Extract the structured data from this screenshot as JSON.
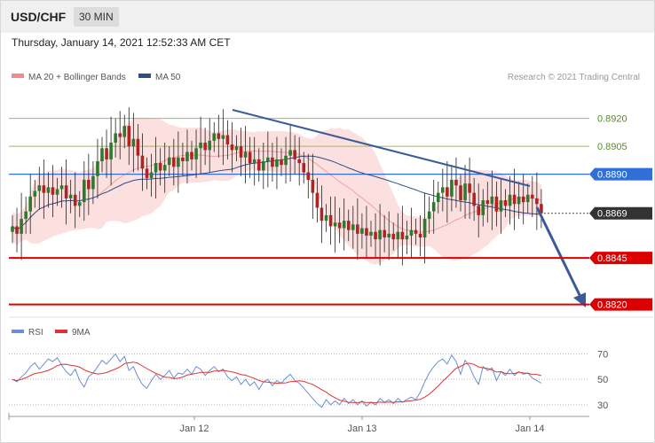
{
  "header": {
    "symbol": "USD/CHF",
    "timeframe": "30 MIN",
    "datetime": "Thursday, January 14, 2021 12:52:33 AM CET"
  },
  "legend": {
    "bb_label": "MA 20 + Bollinger Bands",
    "ma50_label": "MA 50",
    "credit": "Research © 2021 Trading Central",
    "rsi_label": "RSI",
    "ma9_label": "9MA"
  },
  "colors": {
    "up": "#2d7a2d",
    "down": "#b22222",
    "bb": "#f4aaaa",
    "ma50": "#2d4f8a",
    "trend": "#3a5a99",
    "blue_level": "#2f6fd6",
    "red_level": "#dd0000",
    "green_level": "#9bbb59",
    "rsi": "#6b8ed6",
    "rsi_ma": "#dd3333"
  },
  "chart_data": [
    {
      "type": "candlestick",
      "ylim": [
        0.8816,
        0.8937
      ],
      "x_ticks": [
        "Jan 12",
        "Jan 13",
        "Jan 14"
      ],
      "levels": [
        {
          "value": 0.892,
          "label": "0.8920",
          "style": "green"
        },
        {
          "value": 0.8905,
          "label": "0.8905",
          "style": "green"
        },
        {
          "value": 0.889,
          "label": "0.8890",
          "style": "blue"
        },
        {
          "value": 0.8869,
          "label": "0.8869",
          "style": "current"
        },
        {
          "value": 0.8845,
          "label": "0.8845",
          "style": "red"
        },
        {
          "value": 0.882,
          "label": "0.8820",
          "style": "red"
        }
      ],
      "close": [
        0.8862,
        0.8858,
        0.8866,
        0.887,
        0.8878,
        0.8881,
        0.8884,
        0.888,
        0.8883,
        0.8879,
        0.8882,
        0.8884,
        0.8877,
        0.8879,
        0.8873,
        0.8875,
        0.8887,
        0.8882,
        0.8889,
        0.8897,
        0.8904,
        0.8898,
        0.8907,
        0.8912,
        0.891,
        0.8916,
        0.8905,
        0.8909,
        0.89,
        0.8893,
        0.8888,
        0.8891,
        0.8896,
        0.8892,
        0.8895,
        0.8899,
        0.8894,
        0.8899,
        0.8897,
        0.8902,
        0.8898,
        0.8904,
        0.8907,
        0.8903,
        0.8908,
        0.8912,
        0.8909,
        0.8911,
        0.8906,
        0.8903,
        0.8905,
        0.8899,
        0.8902,
        0.8896,
        0.8898,
        0.8892,
        0.8897,
        0.8899,
        0.8894,
        0.8898,
        0.8895,
        0.89,
        0.8903,
        0.8898,
        0.8896,
        0.8891,
        0.8887,
        0.888,
        0.8872,
        0.8865,
        0.8868,
        0.8862,
        0.8864,
        0.8861,
        0.8865,
        0.886,
        0.8863,
        0.8858,
        0.8861,
        0.8857,
        0.8859,
        0.8855,
        0.886,
        0.8856,
        0.8858,
        0.8855,
        0.8859,
        0.8855,
        0.8857,
        0.886,
        0.8858,
        0.8856,
        0.8866,
        0.887,
        0.8875,
        0.888,
        0.8883,
        0.8878,
        0.8887,
        0.8884,
        0.8876,
        0.8885,
        0.888,
        0.8873,
        0.8868,
        0.8876,
        0.8874,
        0.8878,
        0.887,
        0.8876,
        0.8873,
        0.8879,
        0.8874,
        0.8878,
        0.8875,
        0.8879,
        0.8877,
        0.8874,
        0.8869
      ]
    },
    {
      "type": "line",
      "name": "RSI",
      "ylim": [
        25,
        78
      ],
      "levels": [
        70,
        50,
        30
      ],
      "rsi": [
        50,
        48,
        52,
        55,
        60,
        63,
        58,
        62,
        66,
        64,
        67,
        61,
        56,
        53,
        58,
        49,
        44,
        52,
        55,
        60,
        65,
        62,
        66,
        70,
        64,
        68,
        57,
        60,
        52,
        46,
        43,
        49,
        54,
        50,
        53,
        57,
        51,
        55,
        54,
        58,
        54,
        60,
        58,
        53,
        57,
        60,
        56,
        58,
        52,
        49,
        52,
        46,
        50,
        45,
        48,
        42,
        48,
        50,
        45,
        49,
        47,
        51,
        54,
        49,
        47,
        43,
        39,
        35,
        31,
        28,
        34,
        30,
        33,
        30,
        35,
        31,
        34,
        30,
        33,
        29,
        32,
        30,
        35,
        32,
        34,
        31,
        35,
        32,
        34,
        36,
        34,
        40,
        48,
        55,
        60,
        64,
        66,
        62,
        69,
        64,
        54,
        65,
        60,
        52,
        46,
        60,
        57,
        59,
        49,
        56,
        53,
        58,
        53,
        56,
        54,
        55,
        51,
        49,
        47
      ]
    }
  ]
}
